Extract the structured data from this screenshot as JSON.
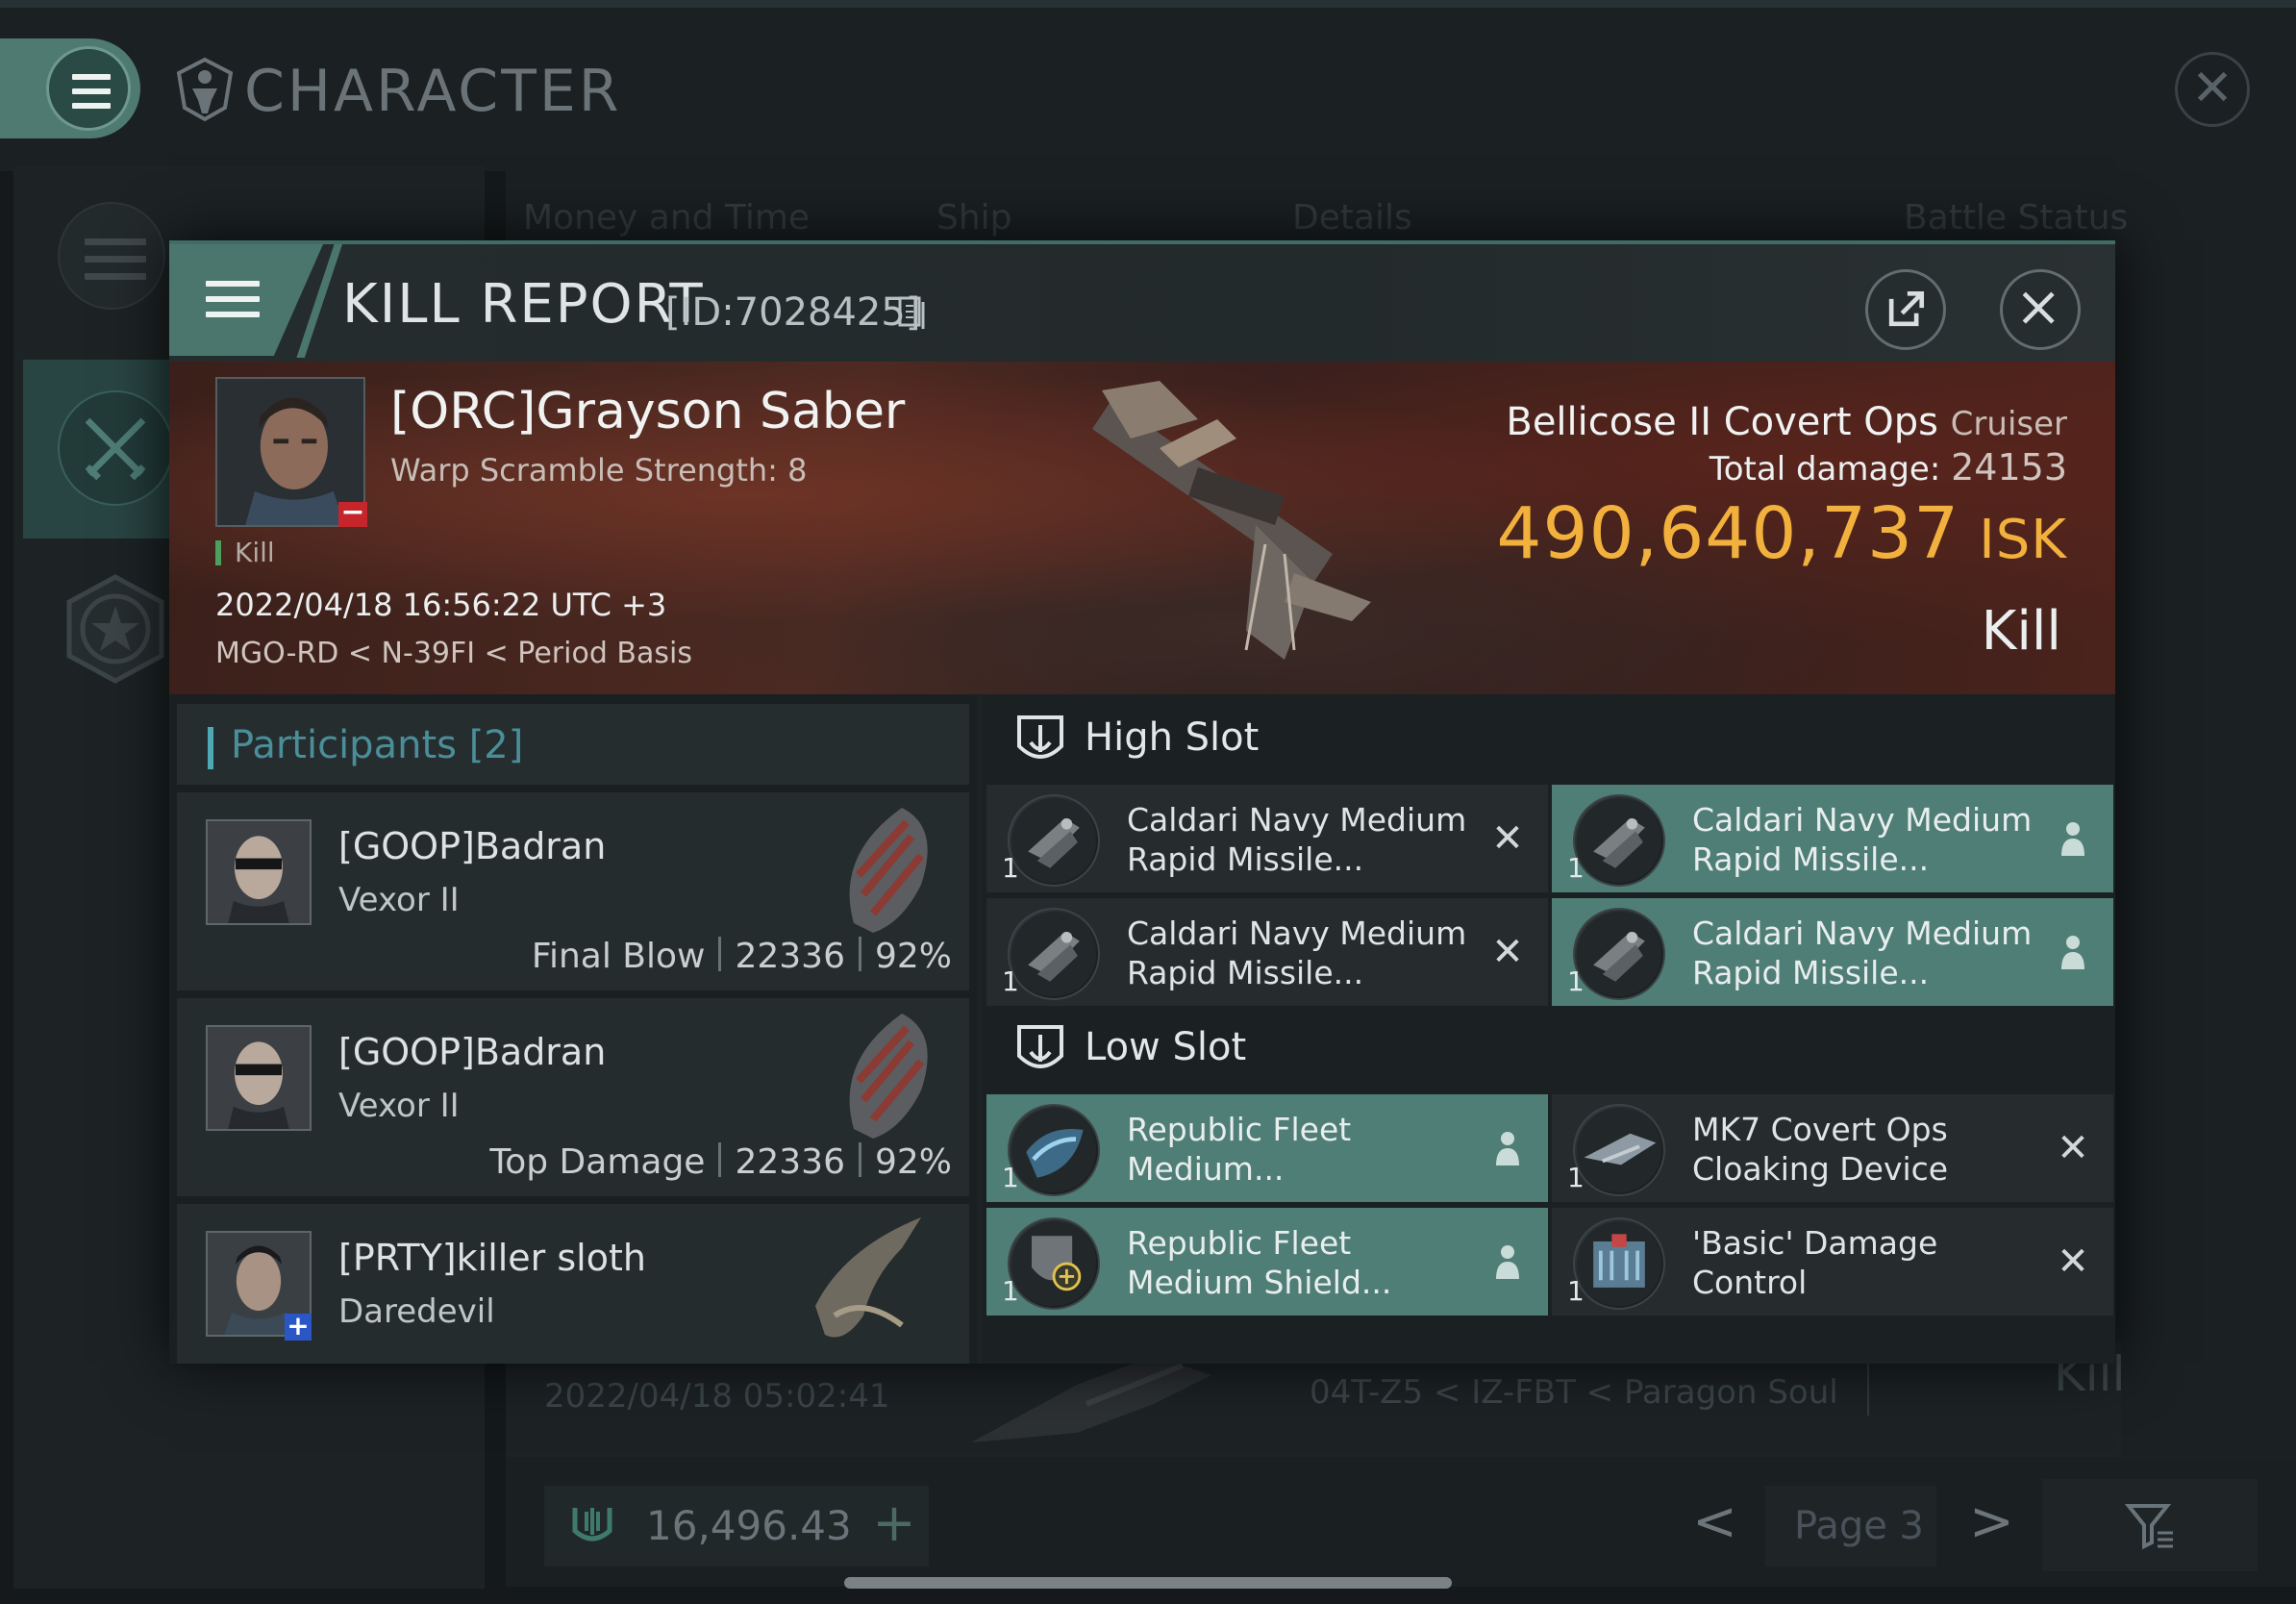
{
  "app": {
    "title": "CHARACTER",
    "background_tabs": [
      "Money and Time",
      "Ship",
      "Details",
      "Battle Status"
    ],
    "background_row": {
      "date": "2022/04/18  05:02:41",
      "location": "04T-Z5 < IZ-FBT < Paragon Soul",
      "result": "Kill"
    },
    "wallet": {
      "amount": "16,496.43",
      "add": "+"
    },
    "pagination": {
      "label": "Page 3",
      "prev": "<",
      "next": ">"
    }
  },
  "kill_report": {
    "title": "KILL REPORT",
    "id_label": "[ID:7028425]",
    "victim": {
      "name": "[ORC]Grayson Saber",
      "subtitle": "Warp Scramble Strength: 8",
      "tag": "Kill",
      "time": "2022/04/18 16:56:22 UTC +3",
      "location": "MGO-RD < N-39FI < Period Basis"
    },
    "ship": {
      "name": "Bellicose II Covert Ops",
      "class": "Cruiser",
      "total_damage_label": "Total damage:",
      "total_damage": "24153",
      "isk_value": "490,640,737",
      "isk_unit": "ISK",
      "result": "Kill"
    },
    "participants": {
      "title": "Participants",
      "count": "[2]",
      "rows": [
        {
          "name": "[GOOP]Badran",
          "ship": "Vexor II",
          "role": "Final Blow",
          "damage": "22336",
          "percent": "92%"
        },
        {
          "name": "[GOOP]Badran",
          "ship": "Vexor II",
          "role": "Top Damage",
          "damage": "22336",
          "percent": "92%"
        },
        {
          "name": "[PRTY]killer sloth",
          "ship": "Daredevil"
        }
      ]
    },
    "fitting": {
      "high_slot": {
        "title": "High Slot",
        "modules": [
          {
            "qty": "1",
            "name": "Caldari Navy Medium Rapid Missile...",
            "status": "destroyed"
          },
          {
            "qty": "1",
            "name": "Caldari Navy Medium Rapid Missile...",
            "status": "dropped"
          },
          {
            "qty": "1",
            "name": "Caldari Navy Medium Rapid Missile...",
            "status": "destroyed"
          },
          {
            "qty": "1",
            "name": "Caldari Navy Medium Rapid Missile...",
            "status": "dropped"
          }
        ]
      },
      "low_slot": {
        "title": "Low Slot",
        "modules": [
          {
            "qty": "1",
            "name": "Republic Fleet Medium...",
            "status": "dropped"
          },
          {
            "qty": "1",
            "name": "MK7 Covert Ops Cloaking Device",
            "status": "destroyed"
          },
          {
            "qty": "1",
            "name": "Republic Fleet Medium Shield...",
            "status": "dropped"
          },
          {
            "qty": "1",
            "name": "'Basic' Damage Control",
            "status": "destroyed"
          }
        ]
      }
    }
  },
  "colors": {
    "accent_teal": "#4f7e76",
    "isk_gold": "#f2b13c",
    "participants_blue": "#4a8e99",
    "kill_green": "#4aa05c"
  }
}
